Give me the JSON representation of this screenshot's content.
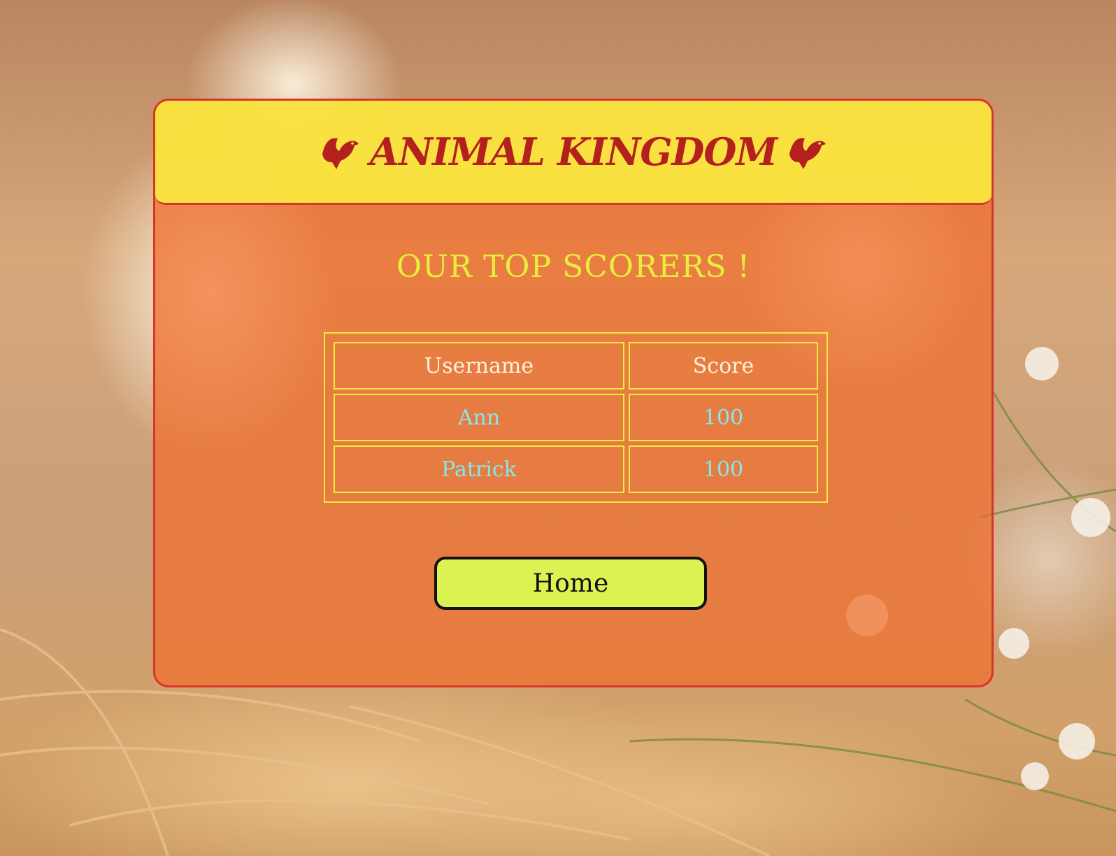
{
  "header": {
    "title": "ANIMAL KINGDOM",
    "left_icon": "bird-icon",
    "right_icon": "bird-icon"
  },
  "main": {
    "subtitle": "OUR TOP SCORERS !",
    "table": {
      "columns": [
        "Username",
        "Score"
      ],
      "rows": [
        {
          "username": "Ann",
          "score": "100"
        },
        {
          "username": "Patrick",
          "score": "100"
        }
      ]
    },
    "home_label": "Home"
  },
  "colors": {
    "header_bg": "#fae841",
    "title": "#b3201d",
    "panel_border": "#d8362b",
    "subtitle": "#e8ee3a",
    "cell_text": "#86e8ec",
    "button_bg": "#dcf152"
  }
}
